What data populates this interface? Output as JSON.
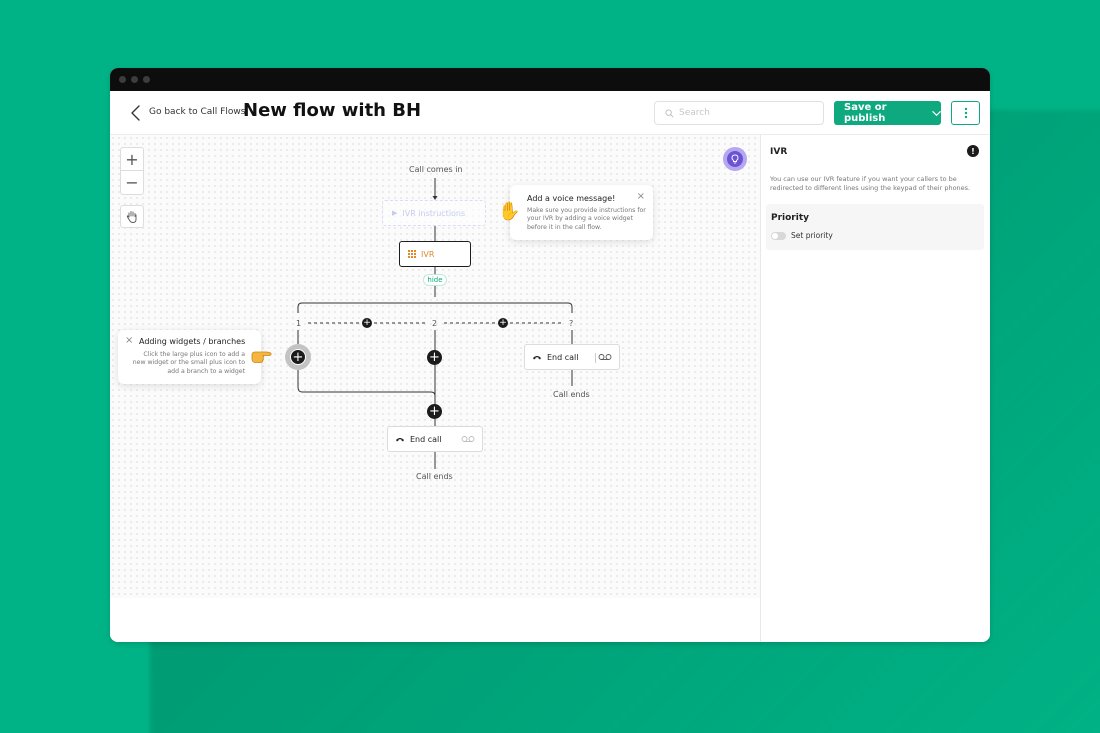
{
  "header": {
    "back_label": "Go back to Call Flows",
    "title": "New flow with BH",
    "search_placeholder": "Search",
    "publish_label": "Save or publish"
  },
  "flow": {
    "start_label": "Call comes in",
    "ivr_instructions_label": "IVR instructions",
    "ivr_label": "IVR",
    "hide_label": "hide",
    "branches": [
      "1",
      "2",
      "?"
    ],
    "end_call_label": "End call",
    "call_ends_label": "Call ends"
  },
  "tips": {
    "voice": {
      "title": "Add a voice message!",
      "body": "Make sure you provide instructions for your IVR by adding a voice widget before it in the call flow."
    },
    "widgets": {
      "title": "Adding widgets / branches",
      "body": "Click the large plus icon to add a new widget or the small plus icon to add a branch to a widget"
    }
  },
  "sidebar": {
    "title": "IVR",
    "description": "You can use our IVR feature if you want your callers to be redirected to different lines using the keypad of their phones.",
    "priority_title": "Priority",
    "set_priority_label": "Set priority"
  },
  "colors": {
    "background": "#00b386",
    "accent": "#0fa97f",
    "ivr": "#e08a2b",
    "bulb": "#6b54d4"
  },
  "icons": {
    "back": "chevron-left-icon",
    "search": "search-icon",
    "publish_chevron": "chevron-down-icon",
    "more": "more-vertical-icon",
    "zoom_in": "plus-icon",
    "zoom_out": "minus-icon",
    "hand": "hand-icon",
    "bulb": "lightbulb-icon",
    "ivr": "keypad-icon",
    "end_call": "phone-hangup-icon",
    "voicemail": "voicemail-icon",
    "wave": "waving-hand-icon",
    "point": "pointing-hand-icon",
    "close": "close-icon",
    "info": "info-icon"
  }
}
